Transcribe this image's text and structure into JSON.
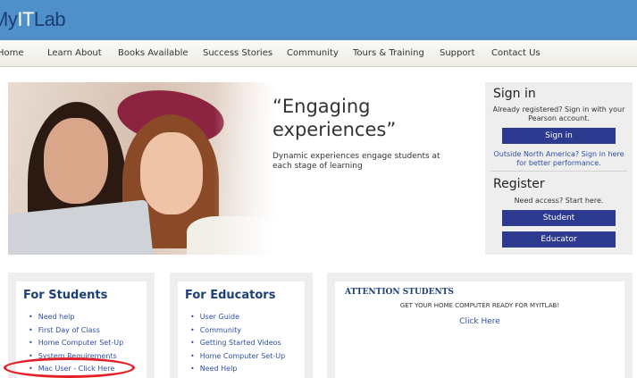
{
  "header": {
    "logo_prefix": "My",
    "logo_it": "IT",
    "logo_suffix": "Lab"
  },
  "nav": {
    "items": [
      "Home",
      "Learn About",
      "Books Available",
      "Success Stories",
      "Community",
      "Tours & Training",
      "Support",
      "Contact Us"
    ]
  },
  "hero": {
    "quote_line1": "“Engaging",
    "quote_line2": "experiences”",
    "subtext": "Dynamic experiences engage students at each stage of learning"
  },
  "signin": {
    "title": "Sign in",
    "text": "Already registered? Sign in with your Pearson account.",
    "button": "Sign in",
    "outside_link": "Outside North America? Sign in here for better performance.",
    "register_title": "Register",
    "register_text": "Need access? Start here.",
    "student_button": "Student",
    "educator_button": "Educator"
  },
  "students": {
    "title": "For Students",
    "links": [
      "Need help",
      "First Day of Class",
      "Home Computer Set-Up",
      "System Requirements",
      "Mac User - Click Here"
    ]
  },
  "educators": {
    "title": "For Educators",
    "links": [
      "User Guide",
      "Community",
      "Getting Started Videos",
      "Home Computer Set-Up",
      "Need Help"
    ]
  },
  "attention": {
    "title": "ATTENTION STUDENTS",
    "subtitle": "GET YOUR HOME COMPUTER READY FOR MYITLAB!",
    "link": "Click Here"
  },
  "colors": {
    "header_bg": "#4f8fca",
    "button_bg": "#2c3b8f",
    "link": "#2f4fa2",
    "title": "#1d3f78",
    "highlight": "#e32027"
  }
}
